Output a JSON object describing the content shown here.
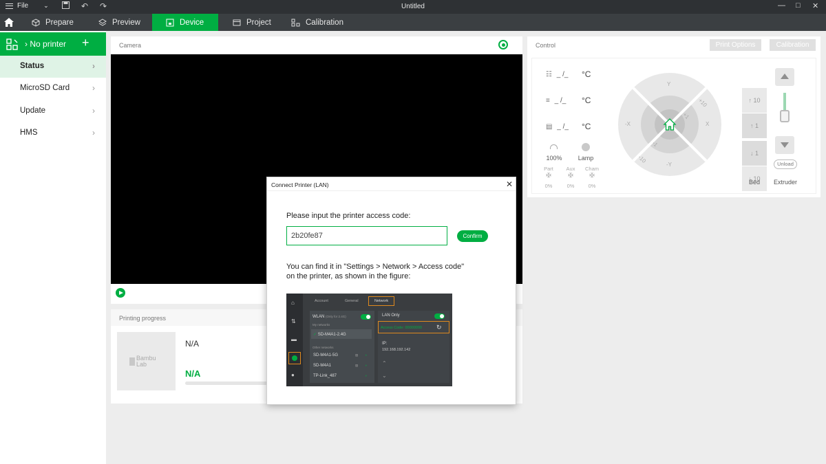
{
  "titlebar": {
    "file_label": "File",
    "document_title": "Untitled"
  },
  "tabs": [
    {
      "label": "Prepare"
    },
    {
      "label": "Preview"
    },
    {
      "label": "Device"
    },
    {
      "label": "Project"
    },
    {
      "label": "Calibration"
    }
  ],
  "sidebar": {
    "printer_label": "No printer",
    "items": [
      {
        "label": "Status"
      },
      {
        "label": "MicroSD Card"
      },
      {
        "label": "Update"
      },
      {
        "label": "HMS"
      }
    ]
  },
  "camera": {
    "title": "Camera"
  },
  "progress": {
    "title": "Printing progress",
    "file_name": "N/A",
    "percent": "N/A",
    "thumb_logo_line1": "Bambu",
    "thumb_logo_line2": "Lab"
  },
  "control": {
    "title": "Control",
    "print_options_label": "Print Options",
    "calibration_label": "Calibration",
    "temps": [
      {
        "value": "_ /_",
        "unit": "°C"
      },
      {
        "value": "_ /_",
        "unit": "°C"
      },
      {
        "value": "_ /_",
        "unit": "°C"
      }
    ],
    "speed_value": "100%",
    "lamp_label": "Lamp",
    "fans": [
      {
        "label": "Part",
        "value": "0%"
      },
      {
        "label": "Aux",
        "value": "0%"
      },
      {
        "label": "Cham",
        "value": "0%"
      }
    ],
    "jog": {
      "y_plus": "Y",
      "y_minus": "-Y",
      "x_plus": "X",
      "x_minus": "-X",
      "plus10": "+10",
      "plus1": "+1",
      "minus1": "-1",
      "minus10": "-10"
    },
    "bed_steps": [
      "10",
      "1",
      "1",
      "10"
    ],
    "bed_label": "Bed",
    "extruder_label": "Extruder",
    "unload_label": "Unload"
  },
  "dialog": {
    "title": "Connect Printer (LAN)",
    "prompt": "Please input the printer access code:",
    "access_code": "2b20fe87",
    "confirm_label": "Confirm",
    "help_line1": "You can find it in \"Settings > Network > Access code\"",
    "help_line2": "on the printer, as shown in the figure:",
    "figure": {
      "tabs": [
        "Account",
        "General",
        "Network"
      ],
      "wlan_label": "WLAN",
      "wlan_note": "(Only for 2.4G)",
      "my_networks_label": "My networks",
      "current_network": "SD-M4A1-2.4G",
      "other_networks_label": "Other networks",
      "other_networks": [
        "SD-M4A1-5G",
        "SD-M4A1",
        "TP-Link_487"
      ],
      "lan_only_label": "LAN Only",
      "access_code_label": "Access Code",
      "access_code_value": "00000000",
      "ip_label": "IP:",
      "ip_value": "192.168.192.142"
    }
  },
  "colors": {
    "accent": "#00ae42",
    "titlebar": "#2e3134",
    "tabbar": "#3b3f42"
  }
}
